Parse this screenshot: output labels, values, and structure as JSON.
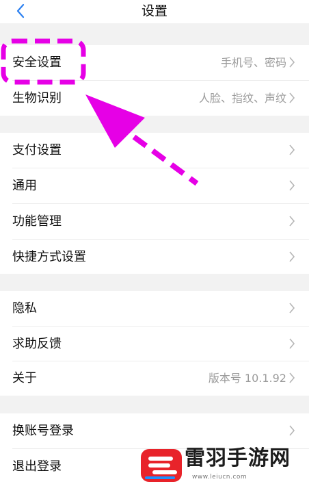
{
  "header": {
    "title": "设置"
  },
  "rows": [
    {
      "label": "安全设置",
      "value": "手机号、密码"
    },
    {
      "label": "生物识别",
      "value": "人脸、指纹、声纹"
    },
    {
      "label": "支付设置",
      "value": ""
    },
    {
      "label": "通用",
      "value": ""
    },
    {
      "label": "功能管理",
      "value": ""
    },
    {
      "label": "快捷方式设置",
      "value": ""
    },
    {
      "label": "隐私",
      "value": ""
    },
    {
      "label": "求助反馈",
      "value": ""
    },
    {
      "label": "关于",
      "value": "版本号 10.1.92"
    },
    {
      "label": "换账号登录",
      "value": ""
    },
    {
      "label": "退出登录",
      "value": ""
    }
  ],
  "annotation": {
    "color": "#e600e6"
  },
  "watermark": {
    "name": "雷羽手游网",
    "url": "www.leiucn.com"
  },
  "colors": {
    "background": "#f2f2f2",
    "text": "#111111",
    "secondary": "#9b9b9b",
    "accent": "#2a7ff0"
  }
}
